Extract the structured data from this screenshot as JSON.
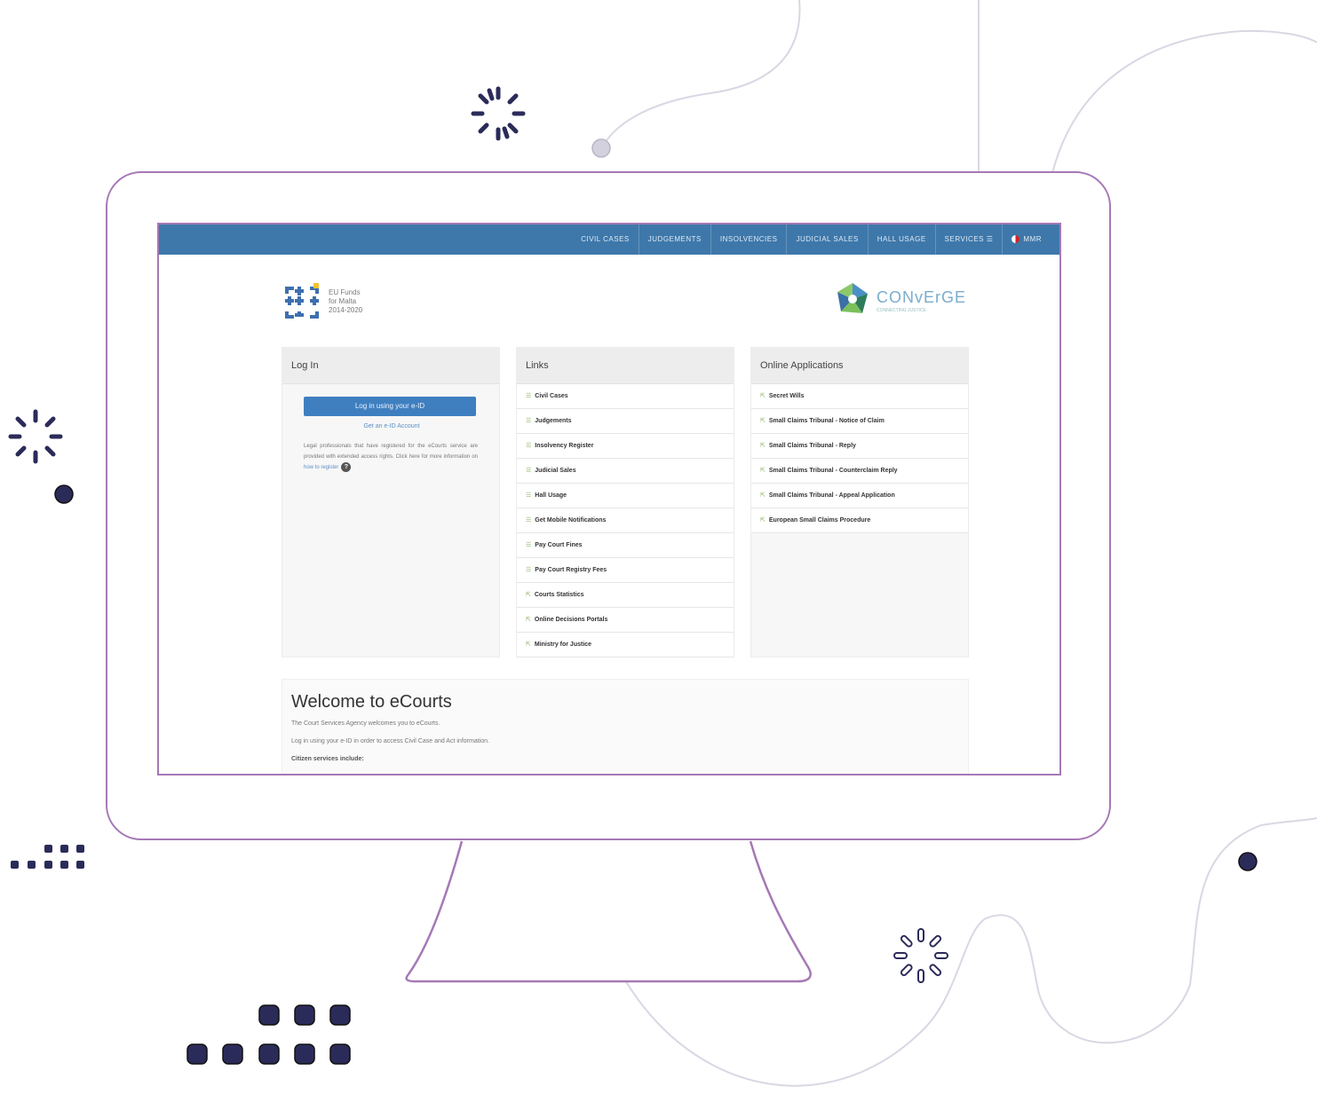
{
  "navbar": {
    "items": [
      "CIVIL CASES",
      "JUDGEMENTS",
      "INSOLVENCIES",
      "JUDICIAL SALES",
      "HALL USAGE",
      "SERVICES ☰",
      "MMR"
    ]
  },
  "logos": {
    "eu_funds": "EU Funds for Malta 2014-2020",
    "eu_lines": [
      "EU Funds",
      "for Malta",
      "2014-2020"
    ],
    "converge": "CONvErGE",
    "converge_sub": "CONNECTING JUSTICE"
  },
  "login": {
    "title": "Log In",
    "button": "Log in using your e-ID",
    "get_account": "Get an e-ID Account",
    "description": "Legal professionals that have registered for the eCourts service are provided with extended access rights. Click here for more information on",
    "how_link": "how to register",
    "help": "?"
  },
  "links": {
    "title": "Links",
    "items": [
      "Civil Cases",
      "Judgements",
      "Insolvency Register",
      "Judicial Sales",
      "Hall Usage",
      "Get Mobile Notifications",
      "Pay Court Fines",
      "Pay Court Registry Fees",
      "Courts Statistics",
      "Online Decisions Portals",
      "Ministry for Justice"
    ]
  },
  "applications": {
    "title": "Online Applications",
    "items": [
      "Secret Wills",
      "Small Claims Tribunal - Notice of Claim",
      "Small Claims Tribunal - Reply",
      "Small Claims Tribunal - Counterclaim Reply",
      "Small Claims Tribunal - Appeal Application",
      "European Small Claims Procedure"
    ]
  },
  "welcome": {
    "title": "Welcome to eCourts",
    "line1": "The Court Services Agency welcomes you to eCourts.",
    "line2": "Log in using your e-ID in order to access Civil Case and Act information.",
    "line3": "Citizen services include:"
  },
  "colors": {
    "frame": "#a678b6",
    "navbar": "#3e78aa",
    "button": "#3f7fc0",
    "decor": "#2b2b5a",
    "curve": "#d9d7e3"
  }
}
